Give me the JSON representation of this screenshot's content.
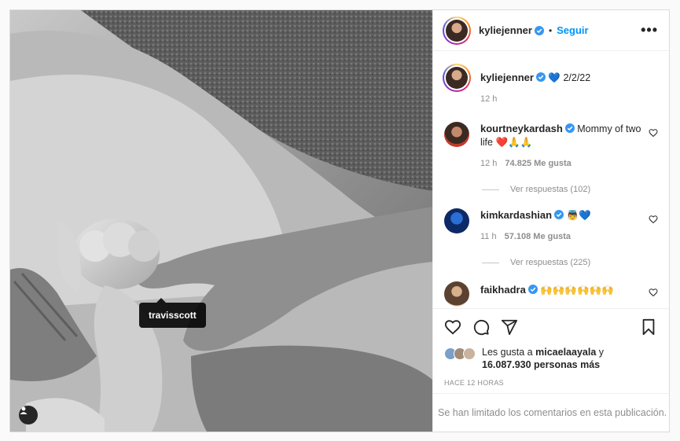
{
  "photo": {
    "tag_username": "travisscott"
  },
  "header": {
    "username": "kyliejenner",
    "separator": "•",
    "follow_label": "Seguir",
    "more_label": "•••"
  },
  "caption": {
    "username": "kyliejenner",
    "text": "💙 2/2/22",
    "time": "12 h"
  },
  "comments": [
    {
      "username": "kourtneykardash",
      "text": "Mommy of two life ❤️🙏🙏",
      "time": "12 h",
      "likes": "74.825 Me gusta",
      "replies": "Ver respuestas (102)"
    },
    {
      "username": "kimkardashian",
      "text": "👼💙",
      "time": "11 h",
      "likes": "57.108 Me gusta",
      "replies": "Ver respuestas (225)"
    },
    {
      "username": "faikhadra",
      "text": "🙌🙌🙌🙌🙌🙌"
    }
  ],
  "likes": {
    "prefix": "Les gusta a",
    "user": "micaelaayala",
    "conj": "y",
    "others": "16.087.930 personas más"
  },
  "time_ago": "HACE 12 HORAS",
  "comments_limited": "Se han limitado los comentarios en esta publicación.",
  "colors": {
    "accent": "#0095f6",
    "heart": "#ed4956",
    "verified": "#3897f0"
  }
}
